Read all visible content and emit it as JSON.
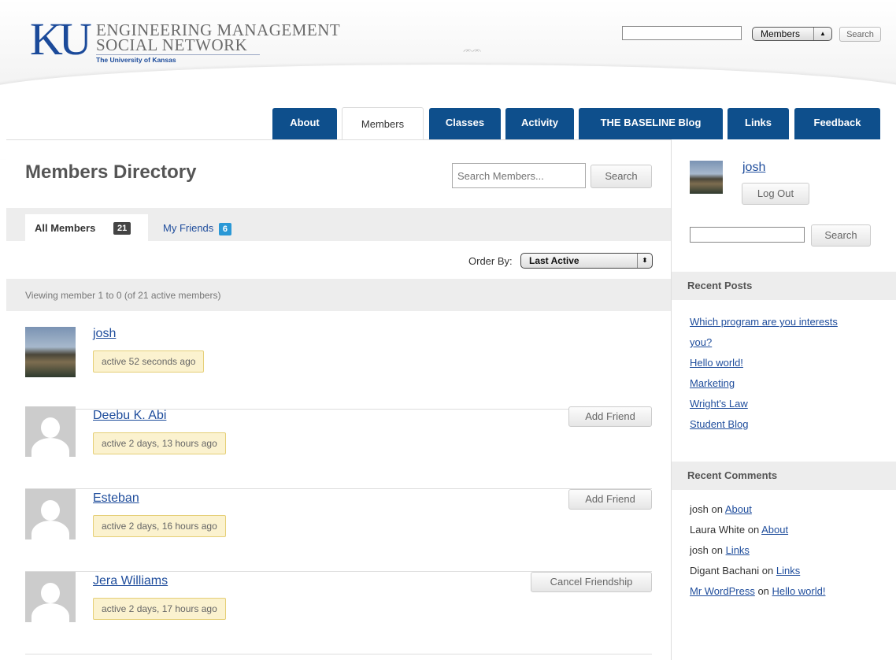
{
  "header": {
    "logo_mark": "KU",
    "logo_line1": "ENGINEERING MANAGEMENT",
    "logo_line2": "SOCIAL NETWORK",
    "logo_sub": "The University of Kansas",
    "search": {
      "value": "",
      "scope": "Members",
      "button_label": "Search"
    }
  },
  "nav": {
    "tabs": [
      {
        "label": "About",
        "active": false
      },
      {
        "label": "Members",
        "active": true
      },
      {
        "label": "Classes",
        "active": false
      },
      {
        "label": "Activity",
        "active": false
      },
      {
        "label": "THE BASELINE Blog",
        "active": false
      },
      {
        "label": "Links",
        "active": false
      },
      {
        "label": "Feedback",
        "active": false
      }
    ]
  },
  "main": {
    "title": "Members Directory",
    "search": {
      "placeholder": "Search Members...",
      "button_label": "Search"
    },
    "subtabs": {
      "all_label": "All Members",
      "all_count": "21",
      "friends_label": "My Friends",
      "friends_count": "6"
    },
    "order_by": {
      "label": "Order By:",
      "value": "Last Active"
    },
    "viewing_text": "Viewing member 1 to 0 (of 21 active members)",
    "members": [
      {
        "name": "josh",
        "activity": "active 52 seconds ago",
        "action": ""
      },
      {
        "name": "Deebu K. Abi",
        "activity": "active 2 days, 13 hours ago",
        "action": "Add Friend"
      },
      {
        "name": "Esteban",
        "activity": "active 2 days, 16 hours ago",
        "action": "Add Friend"
      },
      {
        "name": "Jera Williams",
        "activity": "active 2 days, 17 hours ago",
        "action": "Cancel Friendship"
      }
    ]
  },
  "sidebar": {
    "user": {
      "name": "josh",
      "logout_label": "Log Out"
    },
    "search": {
      "value": "",
      "button_label": "Search"
    },
    "recent_posts": {
      "heading": "Recent Posts",
      "items": [
        "Which program are you interests",
        "you?",
        "Hello world!",
        "Marketing",
        "Wright's Law",
        "Student Blog"
      ]
    },
    "recent_comments": {
      "heading": "Recent Comments",
      "items": [
        {
          "author": "josh",
          "author_link": false,
          "on": "on",
          "target": "About"
        },
        {
          "author": "Laura White",
          "author_link": false,
          "on": "on",
          "target": "About"
        },
        {
          "author": "josh",
          "author_link": false,
          "on": "on",
          "target": "Links"
        },
        {
          "author": "Digant Bachani",
          "author_link": false,
          "on": "on",
          "target": "Links"
        },
        {
          "author": "Mr WordPress",
          "author_link": true,
          "on": "on",
          "target": "Hello world!"
        }
      ]
    }
  },
  "colors": {
    "nav_blue": "#0e4f8c",
    "link_blue": "#1f4d9c",
    "activity_bg": "#fbf2cf",
    "friends_badge": "#2a98d6"
  }
}
